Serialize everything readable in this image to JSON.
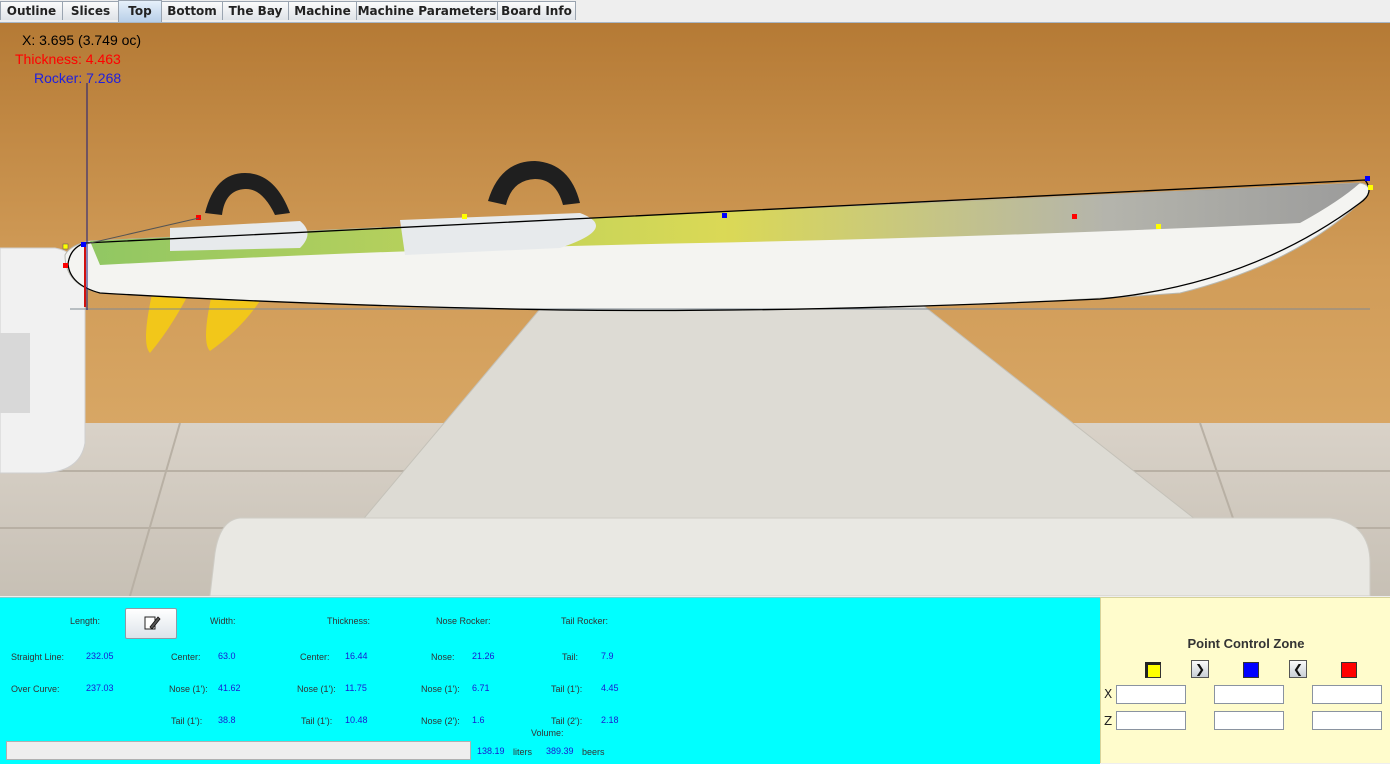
{
  "tabs": [
    "Outline",
    "Slices",
    "Top",
    "Bottom",
    "The Bay",
    "Machine",
    "Machine Parameters",
    "Board Info"
  ],
  "active_tab": "Top",
  "readouts": {
    "x": "X: 3.695 (3.749 oc)",
    "thickness": "Thickness: 4.463",
    "rocker": "Rocker: 7.268"
  },
  "colors": {
    "thickness": "#ff0000",
    "rocker": "#2020dd",
    "stats_bg": "#00ffff",
    "pcz_bg": "#fffccc"
  },
  "stats": {
    "length_label": "Length:",
    "width_label": "Width:",
    "thickness_label": "Thickness:",
    "nose_rocker_label": "Nose Rocker:",
    "tail_rocker_label": "Tail Rocker:",
    "straight_line_label": "Straight Line:",
    "straight_line": "232.05",
    "over_curve_label": "Over Curve:",
    "over_curve": "237.03",
    "width_center_label": "Center:",
    "width_center": "63.0",
    "width_nose1_label": "Nose (1'):",
    "width_nose1": "41.62",
    "width_tail1_label": "Tail (1'):",
    "width_tail1": "38.8",
    "thick_center_label": "Center:",
    "thick_center": "16.44",
    "thick_nose1_label": "Nose (1'):",
    "thick_nose1": "11.75",
    "thick_tail1_label": "Tail (1'):",
    "thick_tail1": "10.48",
    "nose_label": "Nose:",
    "nose": "21.26",
    "nose_1_label": "Nose (1'):",
    "nose_1": "6.71",
    "nose_2_label": "Nose (2'):",
    "nose_2": "1.6",
    "tail_label": "Tail:",
    "tail": "7.9",
    "tail_1_label": "Tail (1'):",
    "tail_1": "4.45",
    "tail_2_label": "Tail (2'):",
    "tail_2": "2.18",
    "volume_label": "Volume:",
    "volume_liters": "138.19",
    "liters_label": "liters",
    "volume_beers": "389.39",
    "beers_label": "beers"
  },
  "edit_button_icon": "pencil-edit-icon",
  "point_control_zone": {
    "title": "Point Control Zone",
    "x_label": "X",
    "z_label": "Z",
    "prev_symbol": "❯",
    "next_symbol": "❮",
    "x_values": [
      "",
      "",
      ""
    ],
    "z_values": [
      "",
      "",
      ""
    ],
    "swatch_colors": [
      "#ffff00",
      "#0000ff",
      "#ff0000"
    ]
  }
}
